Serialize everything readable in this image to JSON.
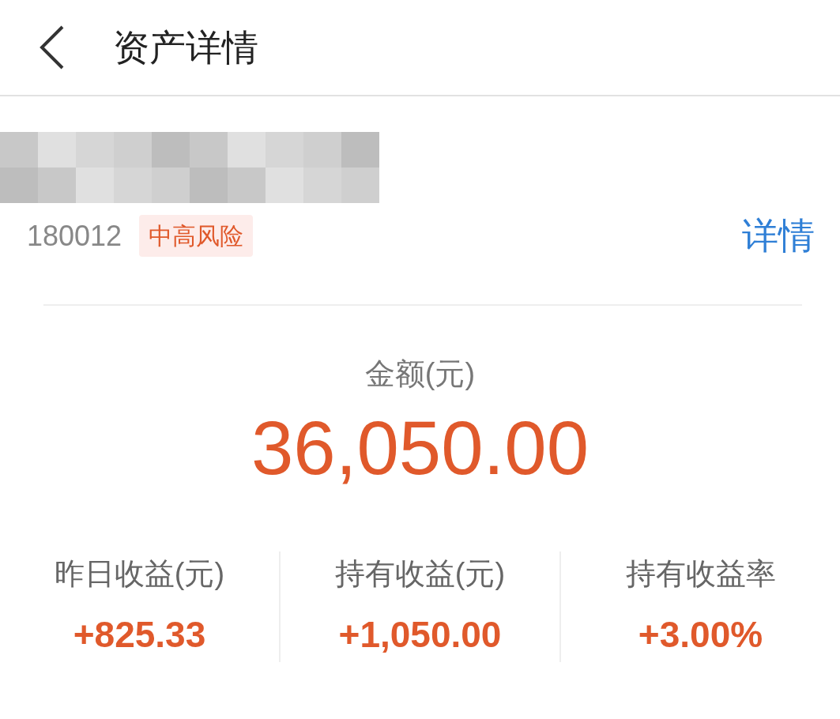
{
  "header": {
    "title": "资产详情"
  },
  "fund": {
    "code": "180012",
    "risk_tag": "中高风险",
    "detail_link": "详情"
  },
  "amount": {
    "label": "金额(元)",
    "value": "36,050.00"
  },
  "stats": [
    {
      "label": "昨日收益(元)",
      "value": "+825.33"
    },
    {
      "label": "持有收益(元)",
      "value": "+1,050.00"
    },
    {
      "label": "持有收益率",
      "value": "+3.00%"
    }
  ]
}
